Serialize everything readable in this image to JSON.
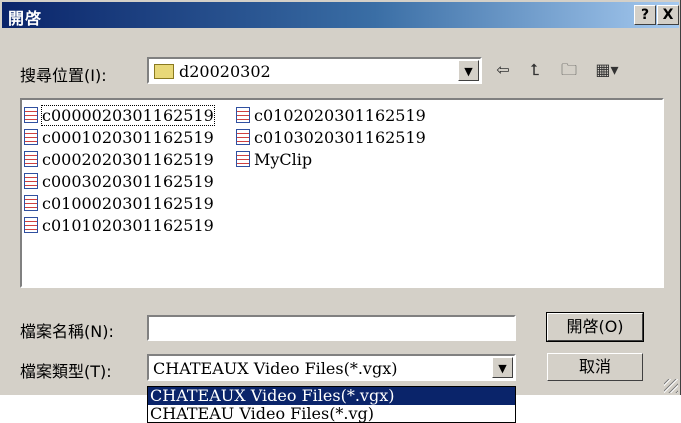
{
  "window": {
    "title": "開啓",
    "help_btn": "?",
    "close_btn": "X"
  },
  "lookin": {
    "label": "搜尋位置(I):",
    "value": "d20020302"
  },
  "toolbar": {
    "back_icon": "back-arrow-icon",
    "up_icon": "folder-up-icon",
    "newfolder_icon": "new-folder-icon",
    "view_icon": "view-menu-icon"
  },
  "files": [
    "c0000020301162519",
    "c0001020301162519",
    "c0002020301162519",
    "c0003020301162519",
    "c0100020301162519",
    "c0101020301162519",
    "c0102020301162519",
    "c0103020301162519",
    "MyClip"
  ],
  "filename": {
    "label": "檔案名稱(N):",
    "value": ""
  },
  "filetype": {
    "label": "檔案類型(T):",
    "value": "CHATEAUX Video Files(*.vgx)"
  },
  "buttons": {
    "open": "開啓(O)",
    "cancel": "取消"
  },
  "filetype_options": [
    "CHATEAUX Video Files(*.vgx)",
    "CHATEAU Video Files(*.vg)"
  ]
}
